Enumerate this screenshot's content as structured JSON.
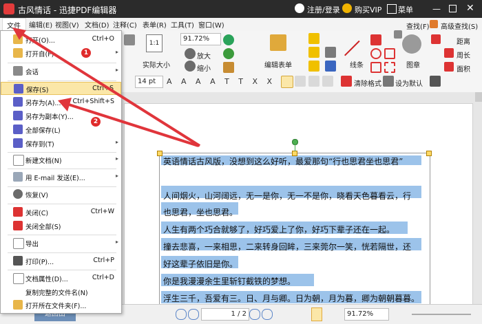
{
  "titlebar": {
    "app_title": "古风情话 - 迅捷PDF编辑器",
    "login": "注册/登录",
    "vip": "购买VIP",
    "menu": "菜单"
  },
  "menubar": [
    "文件",
    "编辑(E)",
    "视图(V)",
    "文档(D)",
    "注释(C)",
    "表单(R)",
    "工具(T)",
    "窗口(W)"
  ],
  "toolbar": {
    "actual_size": "实际大小",
    "zoom_value": "91.72%",
    "zoom_in": "放大",
    "zoom_out": "缩小",
    "edit_form": "编辑表单",
    "lines": "线条",
    "stamp": "图章",
    "find": "查找(F)",
    "advanced_find": "高级查找(S)",
    "distance": "距离",
    "perimeter": "周长",
    "area": "面积",
    "font_size": "14 pt",
    "clear_format": "清除格式",
    "set_default": "设为默认",
    "one_to_one": "1:1"
  },
  "file_menu": {
    "items": [
      {
        "label": "打开(O)...",
        "shortcut": "Ctrl+O",
        "arrow": ""
      },
      {
        "label": "打开自(F)",
        "shortcut": "",
        "arrow": "▸"
      },
      {
        "label": "会话",
        "shortcut": "",
        "arrow": "▸"
      },
      {
        "label": "保存(S)",
        "shortcut": "Ctrl+S",
        "arrow": ""
      },
      {
        "label": "另存为(A)...",
        "shortcut": "Ctrl+Shift+S",
        "arrow": ""
      },
      {
        "label": "另存为副本(Y)...",
        "shortcut": "",
        "arrow": ""
      },
      {
        "label": "全部保存(L)",
        "shortcut": "",
        "arrow": ""
      },
      {
        "label": "保存到(T)",
        "shortcut": "",
        "arrow": "▸"
      },
      {
        "label": "新建文档(N)",
        "shortcut": "",
        "arrow": "▸"
      },
      {
        "label": "用 E-mail 发送(E)...",
        "shortcut": "",
        "arrow": "▸"
      },
      {
        "label": "恢复(V)",
        "shortcut": "",
        "arrow": ""
      },
      {
        "label": "关闭(C)",
        "shortcut": "Ctrl+W",
        "arrow": ""
      },
      {
        "label": "关闭全部(S)",
        "shortcut": "",
        "arrow": ""
      },
      {
        "label": "导出",
        "shortcut": "",
        "arrow": "▸"
      },
      {
        "label": "打印(P)...",
        "shortcut": "Ctrl+P",
        "arrow": ""
      },
      {
        "label": "文档属性(D)...",
        "shortcut": "Ctrl+D",
        "arrow": ""
      },
      {
        "label": "复制完整的文件名(N)",
        "shortcut": "",
        "arrow": ""
      },
      {
        "label": "打开所在文件夹(F)...",
        "shortcut": "",
        "arrow": ""
      }
    ]
  },
  "badges": [
    "1",
    "2"
  ],
  "document": {
    "lines": [
      "英语情话古风版，没想到这么好听，最爱那句“行也思君坐也思君”",
      "人间烟火，山河阔远，无一是你，无一不是你，晓看天色暮看云，行",
      "也思君，坐也思君。",
      "人生有两个巧合就够了，好巧爱上了你，好巧下辈子还在一起。",
      "撞去悲喜，一来相思，二来转身回眸，三来莞尔一笑，恍若隔世，还",
      "好这辈子依旧是你。",
      "你是我漫漫余生里斩钉截铁的梦想。",
      "浮生三千，吾爱有三。日、月与卿。日为朝，月为暮，卿为朝朝暮暮。"
    ]
  },
  "statusbar": {
    "page": "1 / 2",
    "zoom": "91.72%",
    "tab": "返回由"
  }
}
